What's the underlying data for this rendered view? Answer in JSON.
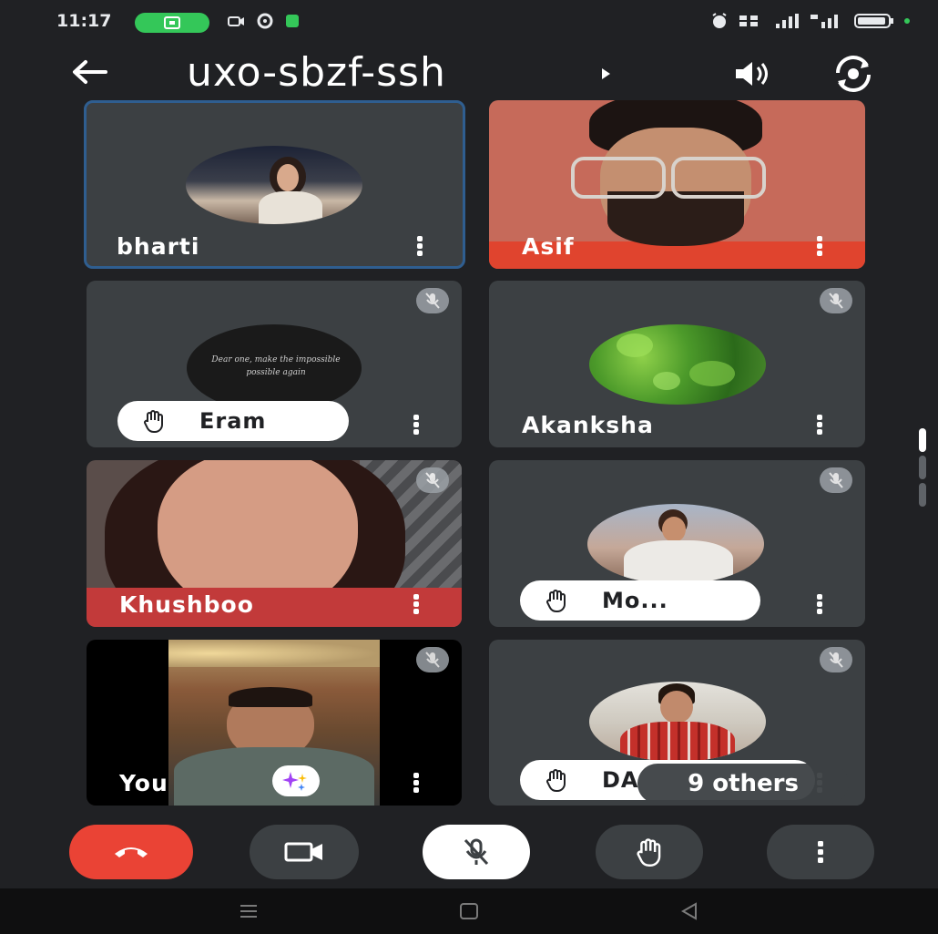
{
  "status": {
    "time": "11:17"
  },
  "meeting": {
    "code": "uxo-sbzf-ssh"
  },
  "participants": {
    "bharti": "bharti",
    "asif": "Asif",
    "eram": "Eram",
    "akanksha": "Akanksha",
    "khushboo": "Khushboo",
    "mo": "Mo...",
    "you": "You",
    "da": "DA"
  },
  "avatar_caption": "Dear one, make the impossible possible again",
  "others": {
    "label": "9 others"
  },
  "colors": {
    "background": "#202124",
    "tile": "#3c4043",
    "end_call": "#ea4335",
    "active_outline": "#2f5e90",
    "pill_green": "#34c759"
  },
  "icons": {
    "back": "arrow-left-icon",
    "speaker": "volume-icon",
    "flip": "camera-flip-icon",
    "mic_off": "mic-off-icon",
    "hand": "raised-hand-icon",
    "camera": "video-camera-icon",
    "end": "phone-hangup-icon",
    "more": "more-vert-icon",
    "effects": "sparkle-effects-icon"
  }
}
